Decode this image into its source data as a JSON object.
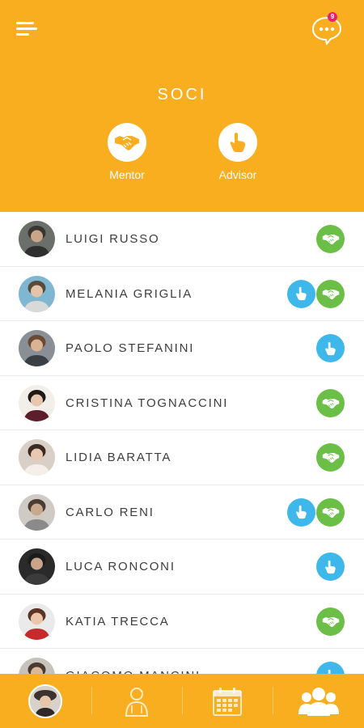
{
  "header": {
    "title": "SOCI",
    "chat_badge_count": "9",
    "roles": [
      {
        "label": "Mentor",
        "icon": "handshake-icon"
      },
      {
        "label": "Advisor",
        "icon": "pointing-hand-icon"
      }
    ]
  },
  "colors": {
    "accent": "#F9AE1F",
    "mentor_green": "#6BBF47",
    "advisor_blue": "#3EB8EA",
    "badge_pink": "#E6206E"
  },
  "members": [
    {
      "name": "LUIGI RUSSO",
      "advisor": false,
      "mentor": true
    },
    {
      "name": "MELANIA GRIGLIA",
      "advisor": true,
      "mentor": true
    },
    {
      "name": "PAOLO STEFANINI",
      "advisor": true,
      "mentor": false
    },
    {
      "name": "CRISTINA TOGNACCINI",
      "advisor": false,
      "mentor": true
    },
    {
      "name": "LIDIA BARATTA",
      "advisor": false,
      "mentor": true
    },
    {
      "name": "CARLO RENI",
      "advisor": true,
      "mentor": true
    },
    {
      "name": "LUCA RONCONI",
      "advisor": true,
      "mentor": false
    },
    {
      "name": "KATIA TRECCA",
      "advisor": false,
      "mentor": true
    },
    {
      "name": "GIACOMO MANCINI",
      "advisor": true,
      "mentor": false
    }
  ],
  "bottom_nav": [
    {
      "icon": "profile-avatar",
      "active": false
    },
    {
      "icon": "person-icon",
      "active": false
    },
    {
      "icon": "calendar-icon",
      "active": false
    },
    {
      "icon": "group-icon",
      "active": true
    }
  ]
}
